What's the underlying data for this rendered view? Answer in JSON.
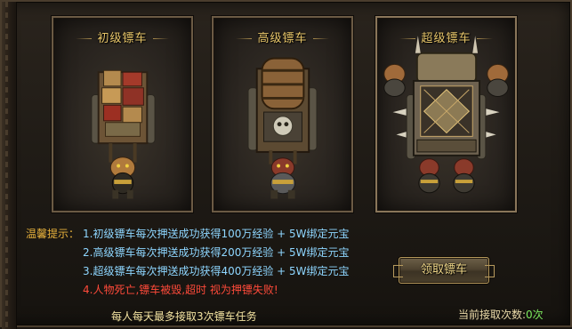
{
  "cards": [
    {
      "title": "初级镖车",
      "tier": "basic"
    },
    {
      "title": "高级镖车",
      "tier": "advanced"
    },
    {
      "title": "超级镖车",
      "tier": "super"
    }
  ],
  "tips": {
    "label": "温馨提示：",
    "lines": [
      "1.初级镖车每次押送成功获得100万经验 + 5W绑定元宝",
      "2.高级镖车每次押送成功获得200万经验 + 5W绑定元宝",
      "3.超级镖车每次押送成功获得400万经验 + 5W绑定元宝",
      "4.人物死亡,镖车被毁,超时 视为押镖失败!"
    ],
    "daily_limit": "每人每天最多接取3次镖车任务"
  },
  "claim_button": {
    "label": "领取镖车"
  },
  "accept_count": {
    "label": "当前接取次数:",
    "value": "0次"
  },
  "colors": {
    "title_gold": "#e8c66a",
    "tip_blue": "#8ed6ff",
    "warn_red": "#ff4a3a",
    "count_green": "#7dea5e"
  }
}
